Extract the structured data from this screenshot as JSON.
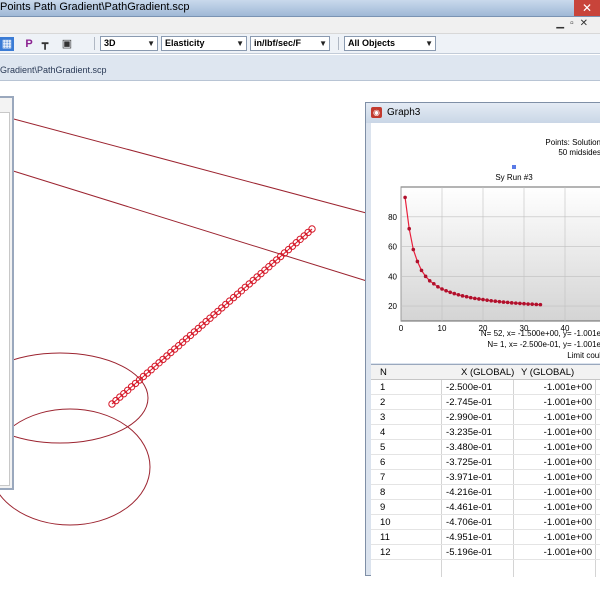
{
  "window": {
    "title": "Points Path Gradient\\PathGradient.scp",
    "close_glyph": "✕"
  },
  "toolbar": {
    "icons": [
      "color-icon",
      "p-icon",
      "pin-icon",
      "printer-icon"
    ],
    "view_mode": "3D",
    "result_type": "Elasticity",
    "units": "in/lbf/sec/F",
    "selection": "All Objects"
  },
  "path_tab": {
    "label": "Gradient\\PathGradient.scp"
  },
  "graph_window": {
    "title": "Graph3",
    "info_line1": "Points: Solution",
    "info_line2": "50 midsides",
    "legend": "Sy Run #3",
    "status_line1": "N=    52,  x= -1.500e+00,  y= -1.001e",
    "status_line2": "N=     1,  x= -2.500e-01,  y= -1.001e",
    "status_line3": "Limit coul"
  },
  "table": {
    "headers": [
      "N",
      "X (GLOBAL)",
      "Y (GLOBAL)"
    ],
    "rows": [
      [
        "1",
        "-2.500e-01",
        "-1.001e+00"
      ],
      [
        "2",
        "-2.745e-01",
        "-1.001e+00"
      ],
      [
        "3",
        "-2.990e-01",
        "-1.001e+00"
      ],
      [
        "4",
        "-3.235e-01",
        "-1.001e+00"
      ],
      [
        "5",
        "-3.480e-01",
        "-1.001e+00"
      ],
      [
        "6",
        "-3.725e-01",
        "-1.001e+00"
      ],
      [
        "7",
        "-3.971e-01",
        "-1.001e+00"
      ],
      [
        "8",
        "-4.216e-01",
        "-1.001e+00"
      ],
      [
        "9",
        "-4.461e-01",
        "-1.001e+00"
      ],
      [
        "10",
        "-4.706e-01",
        "-1.001e+00"
      ],
      [
        "11",
        "-4.951e-01",
        "-1.001e+00"
      ],
      [
        "12",
        "-5.196e-01",
        "-1.001e+00"
      ]
    ]
  },
  "chart_data": {
    "type": "line",
    "title": "",
    "xlabel": "",
    "ylabel": "",
    "xlim": [
      0,
      50
    ],
    "ylim": [
      10,
      100
    ],
    "xticks": [
      0,
      10,
      20,
      30,
      40
    ],
    "yticks": [
      20,
      40,
      60,
      80
    ],
    "grid": true,
    "legend_position": "top",
    "line_color": "#e8203c",
    "marker_color": "#b0102c",
    "series": [
      {
        "name": "Sy Run #3",
        "x": [
          1,
          2,
          3,
          4,
          5,
          6,
          7,
          8,
          9,
          10,
          11,
          12,
          13,
          14,
          15,
          16,
          17,
          18,
          19,
          20,
          21,
          22,
          23,
          24,
          25,
          26,
          27,
          28,
          29,
          30,
          31,
          32,
          33,
          34
        ],
        "y": [
          93,
          72,
          58,
          50,
          44,
          40,
          37,
          35,
          33,
          31.5,
          30.3,
          29.3,
          28.4,
          27.6,
          26.9,
          26.3,
          25.7,
          25.2,
          24.8,
          24.4,
          24,
          23.6,
          23.3,
          23,
          22.7,
          22.5,
          22.2,
          22,
          21.8,
          21.6,
          21.4,
          21.3,
          21.1,
          21
        ]
      }
    ]
  }
}
